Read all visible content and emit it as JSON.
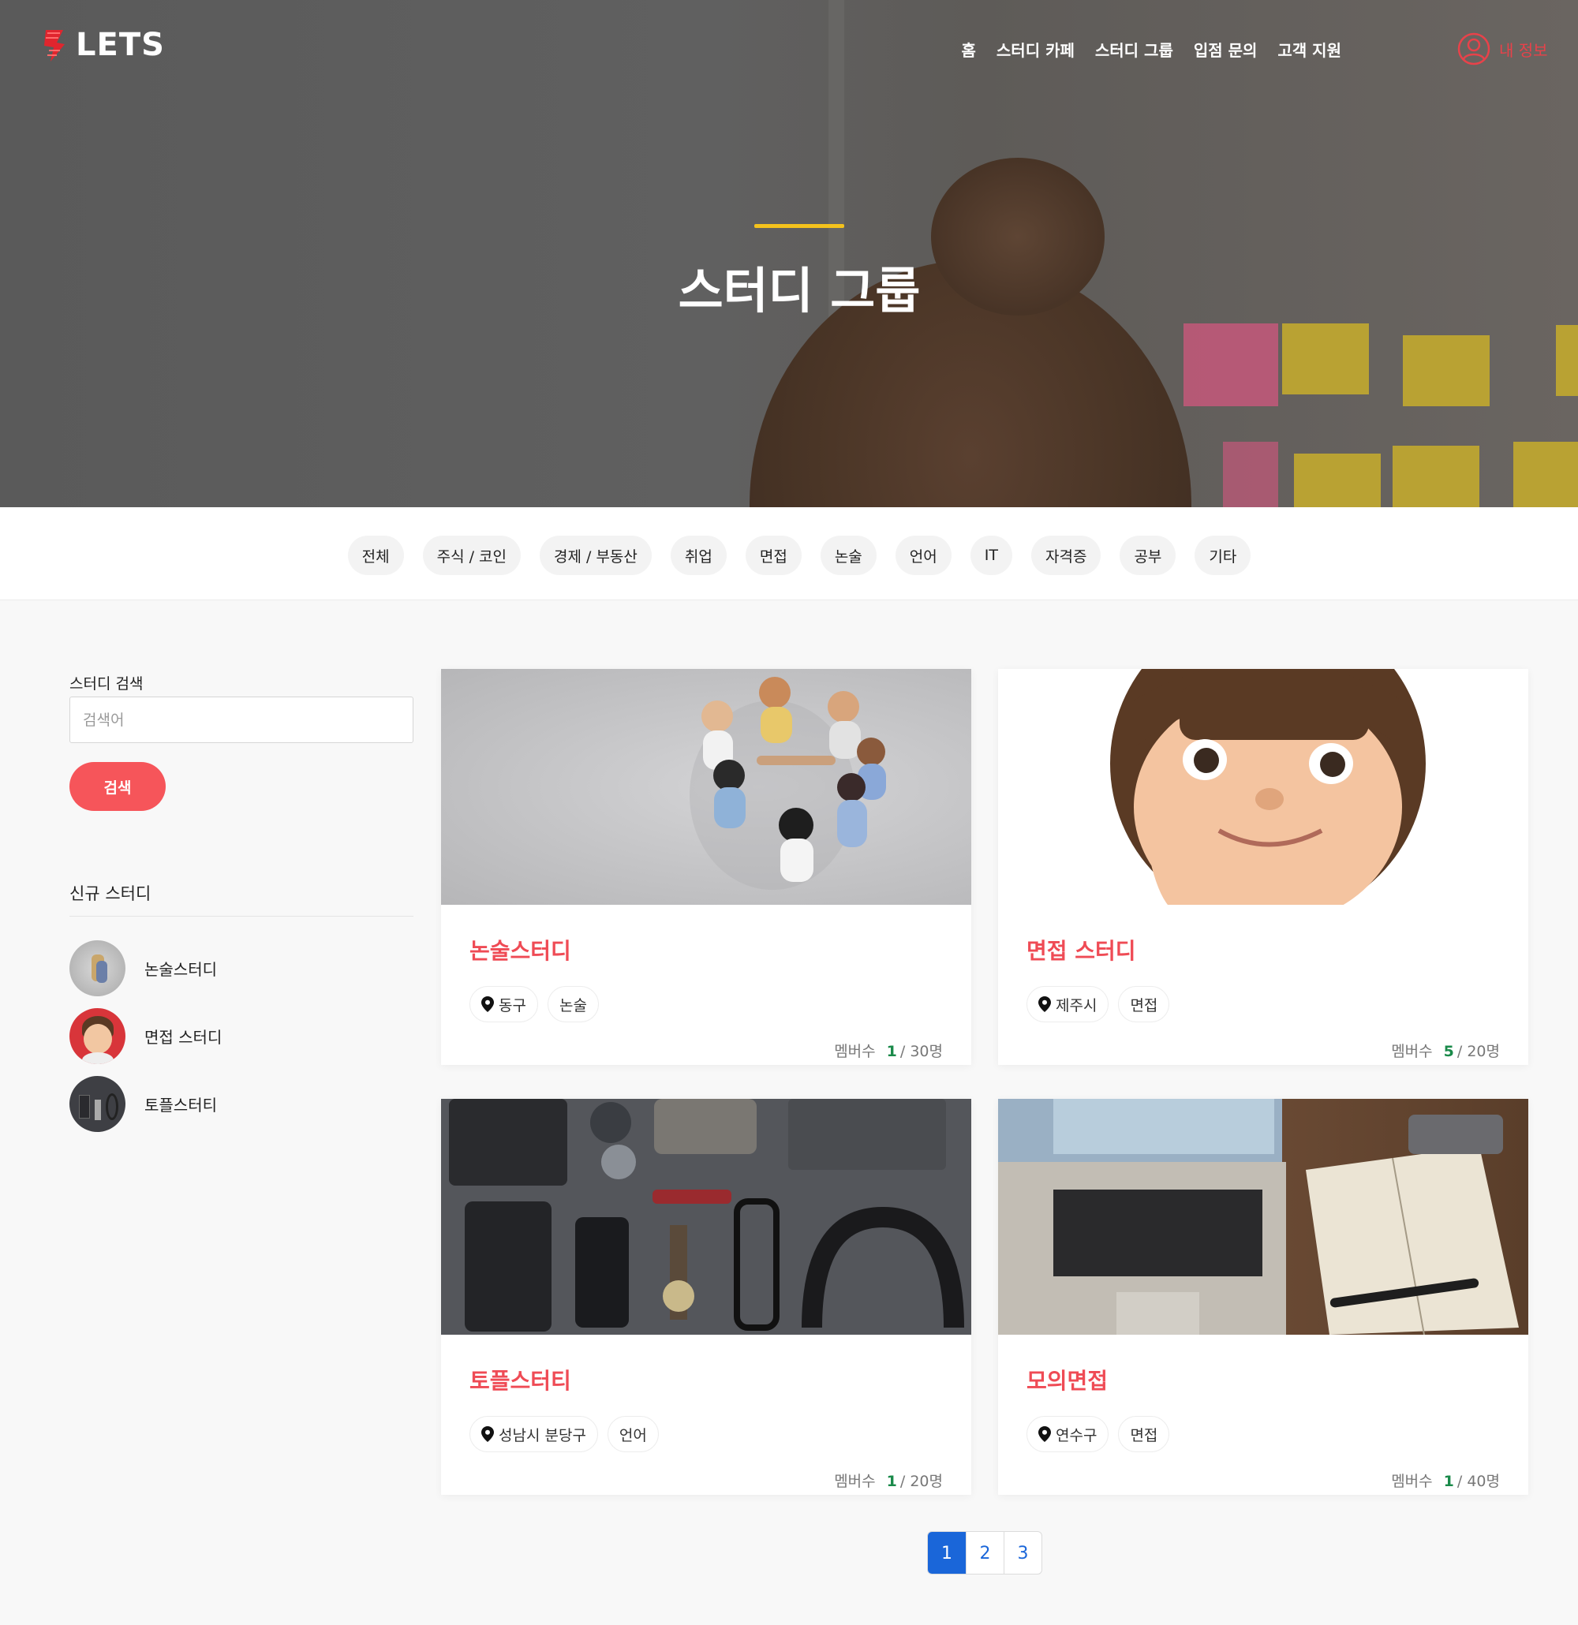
{
  "brand": {
    "name": "LETS",
    "accent": "#e8424a"
  },
  "nav": {
    "links": [
      "홈",
      "스터디 카페",
      "스터디 그룹",
      "입점 문의",
      "고객 지원"
    ],
    "my_info": "내 정보"
  },
  "hero": {
    "title": "스터디 그룹"
  },
  "categories": [
    "전체",
    "주식 / 코인",
    "경제 / 부동산",
    "취업",
    "면접",
    "논술",
    "언어",
    "IT",
    "자격증",
    "공부",
    "기타"
  ],
  "sidebar": {
    "search_label": "스터디 검색",
    "search_placeholder": "검색어",
    "search_button": "검색",
    "new_title": "신규 스터디",
    "new_items": [
      {
        "label": "논술스터디"
      },
      {
        "label": "면접 스터디"
      },
      {
        "label": "토플스터티"
      }
    ]
  },
  "cards": [
    {
      "title": "논술스터디",
      "location": "동구",
      "category": "논술",
      "members_label": "멤버수",
      "members": "1",
      "capacity": "/ 30명"
    },
    {
      "title": "면접 스터디",
      "location": "제주시",
      "category": "면접",
      "members_label": "멤버수",
      "members": "5",
      "capacity": "/ 20명"
    },
    {
      "title": "토플스터티",
      "location": "성남시 분당구",
      "category": "언어",
      "members_label": "멤버수",
      "members": "1",
      "capacity": "/ 20명"
    },
    {
      "title": "모의면접",
      "location": "연수구",
      "category": "면접",
      "members_label": "멤버수",
      "members": "1",
      "capacity": "/ 40명"
    }
  ],
  "pagination": {
    "pages": [
      "1",
      "2",
      "3"
    ],
    "current": "1"
  }
}
